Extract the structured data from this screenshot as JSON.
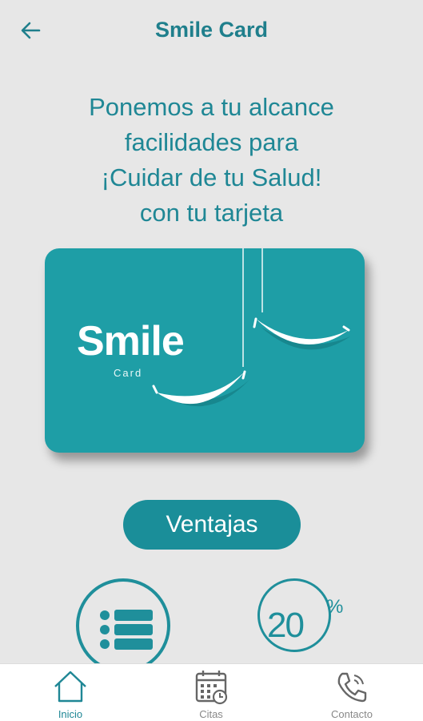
{
  "header": {
    "title": "Smile Card",
    "back_icon": "arrow-left-icon"
  },
  "headline": {
    "lines": [
      "Ponemos a tu alcance",
      "facilidades para",
      "¡Cuidar de tu Salud!",
      "con tu tarjeta"
    ]
  },
  "card": {
    "brand": "Smile",
    "sub": "Card",
    "color": "#1e9ea6"
  },
  "ventajas_button": "Ventajas",
  "features": {
    "list_icon": "list-icon",
    "discount_value": "20",
    "discount_symbol": "%"
  },
  "bottom_nav": {
    "items": [
      {
        "label": "Inicio",
        "icon": "home-icon",
        "active": true
      },
      {
        "label": "Citas",
        "icon": "calendar-icon",
        "active": false
      },
      {
        "label": "Contacto",
        "icon": "phone-icon",
        "active": false
      }
    ]
  },
  "colors": {
    "accent": "#1f8795",
    "background": "#e7e7e7"
  }
}
